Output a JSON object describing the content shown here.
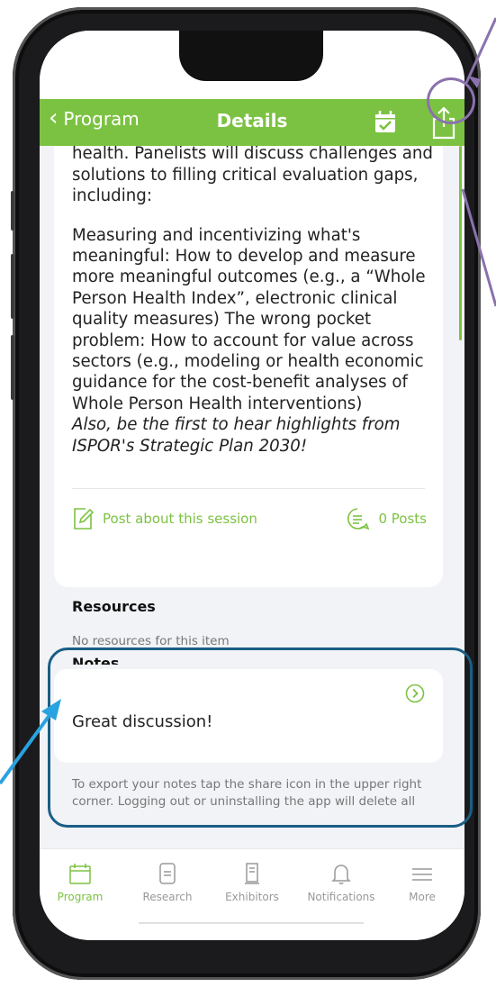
{
  "navbar": {
    "back_label": "Program",
    "title": "Details",
    "background": "#7cc242",
    "icons": [
      "calendar-check-icon",
      "share-icon"
    ]
  },
  "session": {
    "description_partial": "interventions designed to support whole health. Panelists will discuss challenges and solutions to filling critical evaluation gaps, including:",
    "description_body": "Measuring and incentivizing what's meaningful: How to develop and measure more meaningful outcomes (e.g., a “Whole Person Health Index”, electronic clinical quality measures) The wrong pocket problem: How to account for value across sectors (e.g., modeling or health economic guidance for the cost-benefit analyses of Whole Person Health interventions)",
    "description_italic": "Also, be the first to hear highlights from ISPOR's Strategic Plan 2030!",
    "post_label": "Post about this session",
    "posts_count": "0 Posts"
  },
  "resources": {
    "heading": "Resources",
    "empty_text": "No resources for this item"
  },
  "notes": {
    "heading": "Notes",
    "note_text": "Great discussion!",
    "help_text": "To export your notes tap the share icon in the upper right corner. Logging out or uninstalling the app will delete all notes."
  },
  "tabbar": {
    "items": [
      {
        "label": "Program",
        "icon": "calendar-icon",
        "active": true
      },
      {
        "label": "Research",
        "icon": "document-icon",
        "active": false
      },
      {
        "label": "Exhibitors",
        "icon": "booth-icon",
        "active": false
      },
      {
        "label": "Notifications",
        "icon": "bell-icon",
        "active": false
      },
      {
        "label": "More",
        "icon": "menu-icon",
        "active": false
      }
    ]
  },
  "annotation_colors": {
    "notes_highlight": "#1a5e85",
    "share_highlight": "#8a72ad",
    "blue_arrow": "#29a3e0",
    "purple_line": "#8a72ad"
  }
}
